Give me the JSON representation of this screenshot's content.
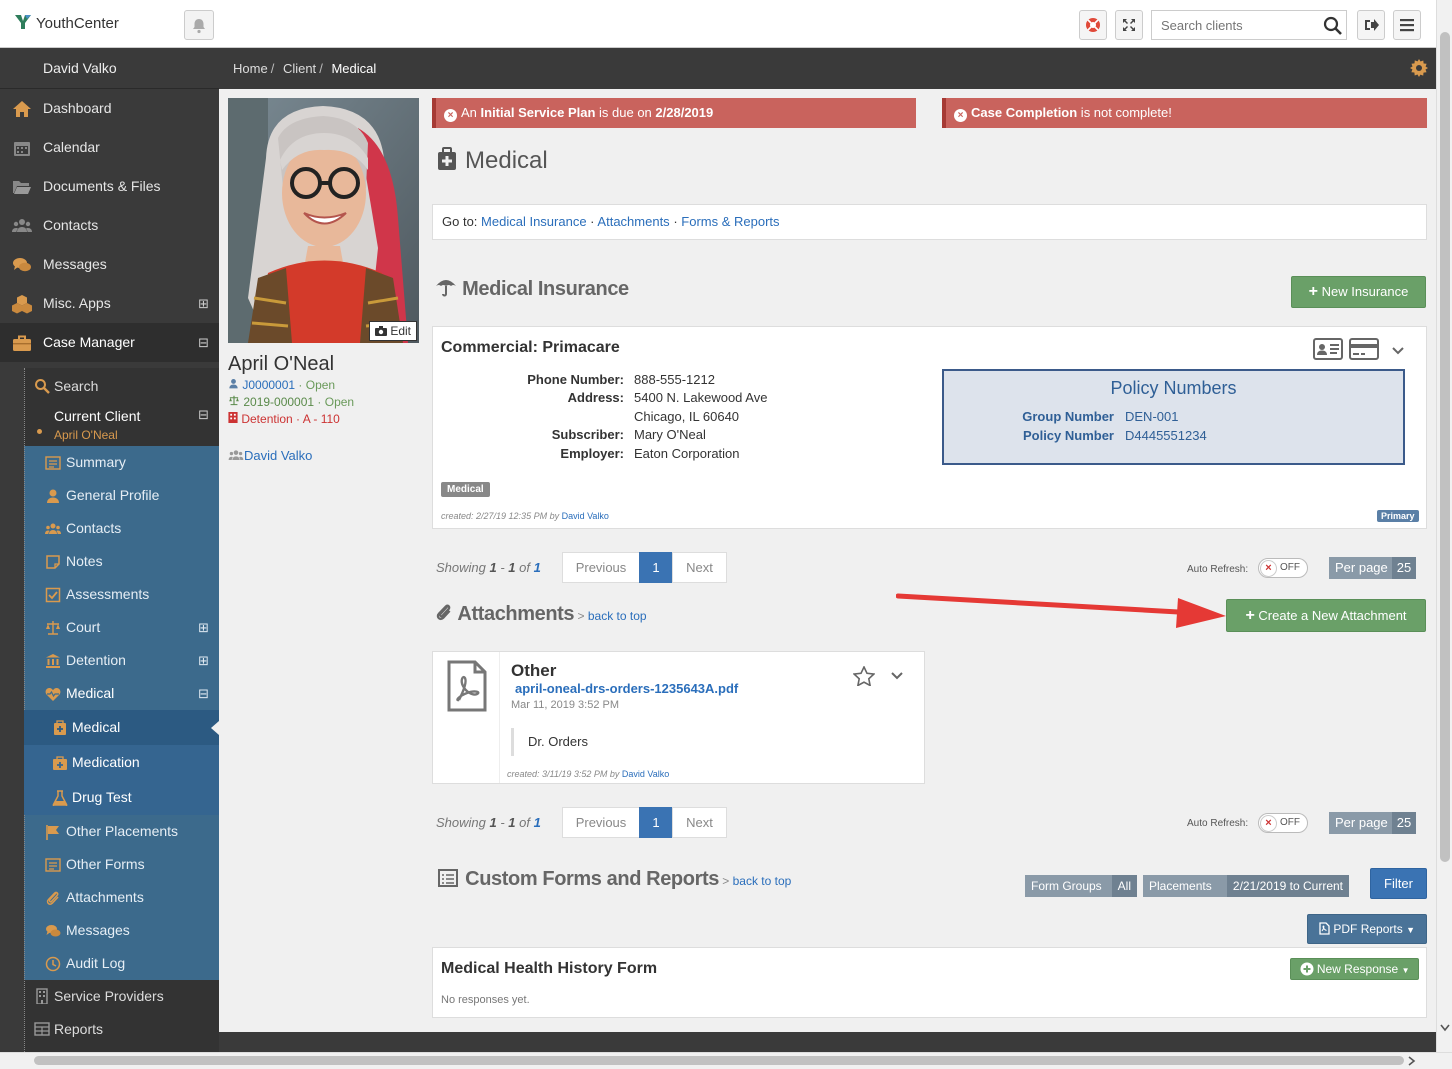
{
  "app": {
    "name": "YouthCenter"
  },
  "topbar": {
    "search_placeholder": "Search clients"
  },
  "sidebar": {
    "user": "David Valko",
    "items": [
      {
        "label": "Dashboard"
      },
      {
        "label": "Calendar"
      },
      {
        "label": "Documents & Files"
      },
      {
        "label": "Contacts"
      },
      {
        "label": "Messages"
      },
      {
        "label": "Misc. Apps",
        "toggle": "⊞"
      },
      {
        "label": "Case Manager",
        "toggle": "⊟"
      }
    ],
    "case_manager": {
      "search": "Search",
      "current_client": "Current Client",
      "current_client_toggle": "⊟",
      "client_name": "April O'Neal",
      "client_items": [
        {
          "label": "Summary"
        },
        {
          "label": "General Profile"
        },
        {
          "label": "Contacts"
        },
        {
          "label": "Notes"
        },
        {
          "label": "Assessments"
        },
        {
          "label": "Court",
          "toggle": "⊞"
        },
        {
          "label": "Detention",
          "toggle": "⊞"
        },
        {
          "label": "Medical",
          "toggle": "⊟"
        }
      ],
      "medical_items": [
        {
          "label": "Medical"
        },
        {
          "label": "Medication"
        },
        {
          "label": "Drug Test"
        }
      ],
      "more_items": [
        {
          "label": "Other Placements"
        },
        {
          "label": "Other Forms"
        },
        {
          "label": "Attachments"
        },
        {
          "label": "Messages"
        },
        {
          "label": "Audit Log"
        }
      ],
      "bottom_items": [
        {
          "label": "Service Providers"
        },
        {
          "label": "Reports"
        }
      ]
    }
  },
  "breadcrumb": [
    "Home",
    "Client",
    "Medical"
  ],
  "client": {
    "name": "April O'Neal",
    "photo_edit": "Edit",
    "case_id": "J0000001",
    "case_status": "· Open",
    "court_id": "2019-000001",
    "court_status": "· Open",
    "detention": "Detention · A - 110",
    "worker": "David Valko"
  },
  "alerts": [
    {
      "pre": "An ",
      "bold": "Initial Service Plan",
      "mid": " is due on ",
      "bold2": "2/28/2019",
      "post": ""
    },
    {
      "pre": "",
      "bold": "Case Completion",
      "mid": " is not complete!",
      "bold2": "",
      "post": ""
    }
  ],
  "page": {
    "title": "Medical"
  },
  "goto": {
    "label": "Go to:",
    "links": [
      "Medical Insurance",
      "Attachments",
      "Forms & Reports"
    ],
    "sep": "·"
  },
  "insurance": {
    "title": "Medical Insurance",
    "new_button": "New Insurance",
    "card": {
      "heading": "Commercial: Primacare",
      "fields": [
        {
          "label": "Phone Number:",
          "value": "888-555-1212"
        },
        {
          "label": "Address:",
          "value": "5400 N. Lakewood Ave"
        },
        {
          "label": "",
          "value": "Chicago, IL 60640"
        },
        {
          "label": "Subscriber:",
          "value": "Mary O'Neal"
        },
        {
          "label": "Employer:",
          "value": "Eaton Corporation"
        }
      ],
      "policy": {
        "title": "Policy Numbers",
        "group_label": "Group Number",
        "group_value": "DEN-001",
        "policy_label": "Policy Number",
        "policy_value": "D4445551234"
      },
      "tag": "Medical",
      "created": "created: 2/27/19 12:35 PM by ",
      "created_by": "David Valko",
      "primary": "Primary"
    }
  },
  "pager1": {
    "showing": "Showing",
    "from": "1",
    "dash": " - ",
    "to": "1",
    "of": " of ",
    "total": "1",
    "prev": "Previous",
    "page": "1",
    "next": "Next",
    "auto_refresh": "Auto Refresh:",
    "toggle": "OFF",
    "per_page": "Per page",
    "per_page_value": "25"
  },
  "attachments": {
    "title": "Attachments",
    "back": "back to top",
    "create_button": "Create a New Attachment",
    "item": {
      "type": "Other",
      "file": "april-oneal-drs-orders-1235643A.pdf",
      "date": "Mar 11, 2019 3:52 PM",
      "note": "Dr. Orders",
      "created": "created: 3/11/19 3:52 PM by ",
      "created_by": "David Valko"
    }
  },
  "pager2": {
    "showing": "Showing",
    "from": "1",
    "dash": " - ",
    "to": "1",
    "of": " of ",
    "total": "1",
    "prev": "Previous",
    "page": "1",
    "next": "Next",
    "auto_refresh": "Auto Refresh:",
    "toggle": "OFF",
    "per_page": "Per page",
    "per_page_value": "25"
  },
  "forms": {
    "title": "Custom Forms and Reports",
    "back": "back to top",
    "form_groups_label": "Form Groups",
    "form_groups_value": "All",
    "placements_label": "Placements",
    "placements_value": "2/21/2019 to Current",
    "filter_button": "Filter",
    "pdf_button": "PDF Reports",
    "form": {
      "title": "Medical Health History Form",
      "empty": "No responses yet.",
      "new_button": "New Response"
    }
  },
  "colors": {
    "alert": "#c9635d",
    "green": "#6aa068",
    "blue": "#3a73b3",
    "sidebar": "#3a3a3a",
    "sidebar_blue": "#3c6a8c",
    "arrow": "#e53935"
  }
}
